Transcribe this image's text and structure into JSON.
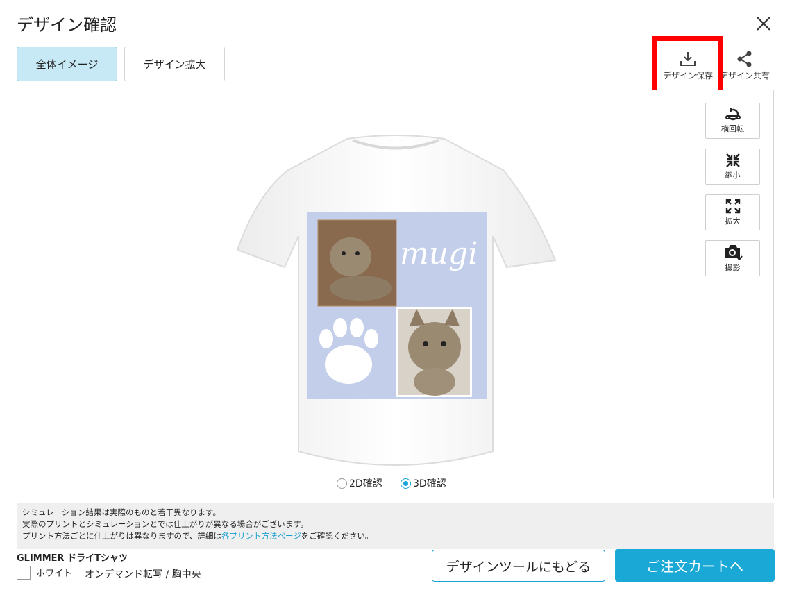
{
  "dialog": {
    "title": "デザイン確認"
  },
  "tabs": [
    {
      "label": "全体イメージ",
      "active": true
    },
    {
      "label": "デザイン拡大",
      "active": false
    }
  ],
  "top_actions": {
    "save_label": "デザイン保存",
    "share_label": "デザイン共有"
  },
  "tools": [
    {
      "label": "横回転",
      "icon": "rotate-icon"
    },
    {
      "label": "縮小",
      "icon": "shrink-icon"
    },
    {
      "label": "拡大",
      "icon": "expand-icon"
    },
    {
      "label": "撮影",
      "icon": "camera-icon"
    }
  ],
  "design": {
    "text": "mugi"
  },
  "view_mode": {
    "option_2d": "2D確認",
    "option_3d": "3D確認",
    "selected": "3D確認"
  },
  "notes": {
    "line1": "シミュレーション結果は実際のものと若干異なります。",
    "line2": "実際のプリントとシミュレーションとでは仕上がりが異なる場合がございます。",
    "line3_pre": "プリント方法ごとに仕上がりは異なりますので、詳細は",
    "line3_link": "各プリント方法ページ",
    "line3_post": "をご確認ください。"
  },
  "product": {
    "name": "GLIMMER ドライTシャツ",
    "color": "ホワイト",
    "print_method": "オンデマンド転写 / 胸中央"
  },
  "buttons": {
    "back": "デザインツールにもどる",
    "cart": "ご注文カートへ"
  },
  "colors": {
    "accent": "#1aa8d6",
    "highlight": "#ff0000",
    "design_bg": "#c3cfea"
  }
}
